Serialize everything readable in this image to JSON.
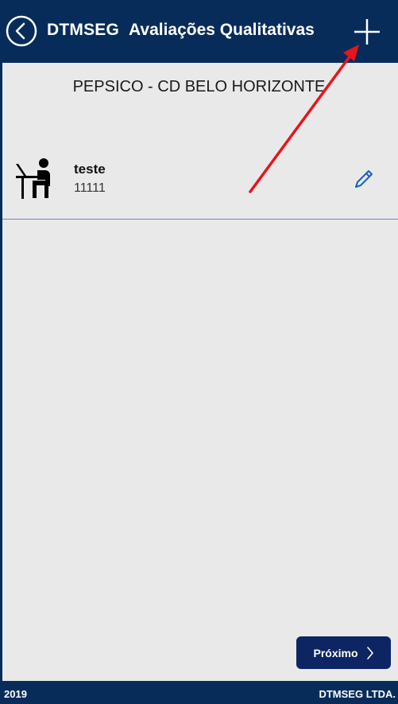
{
  "header": {
    "brand": "DTMSEG",
    "title": "Avaliações Qualitativas",
    "back_icon": "chevron-left-circle-icon",
    "add_icon": "plus-icon"
  },
  "subheader": {
    "text": "PEPSICO - CD BELO HORIZONTE"
  },
  "list": {
    "items": [
      {
        "icon": "worker-at-desk-icon",
        "title": "teste",
        "subtitle": "11111",
        "action_icon": "pencil-icon"
      }
    ]
  },
  "actions": {
    "next_label": "Próximo",
    "next_icon": "chevron-right-icon"
  },
  "footer": {
    "year": "2019",
    "company": "DTMSEG LTDA."
  },
  "colors": {
    "header_bg": "#082c5a",
    "button_bg": "#0d2563",
    "page_bg": "#e9e9e9",
    "annotation_arrow": "#e8141b",
    "edit_icon": "#1c5fb8"
  }
}
